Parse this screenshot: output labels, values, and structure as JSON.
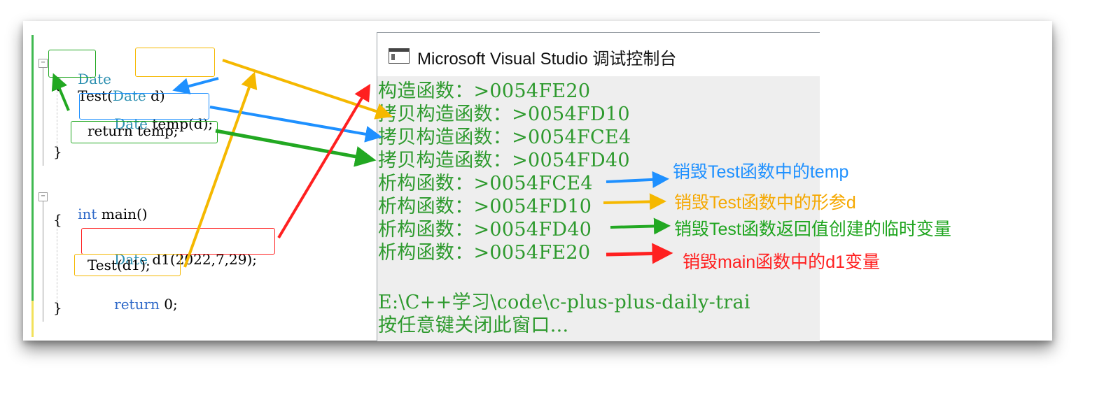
{
  "editor": {
    "code_lines": {
      "line1": {
        "type": "Date",
        "name": "Test",
        "param_type": "Date",
        "param_name": "d",
        "paren_open": "(",
        "paren_close": ")"
      },
      "line2": "{",
      "line3": {
        "type": "Date",
        "rest": "temp(d);"
      },
      "line4": "return temp;",
      "line5": "}",
      "line6": {
        "kw": "int",
        "rest": " main()"
      },
      "line7": "{",
      "line8": {
        "type": "Date",
        "rest": "d1(2022,7,29);"
      },
      "line9": "Test(d1);",
      "line10": {
        "kw": "return",
        "rest": " 0;"
      },
      "line11": "}"
    },
    "fold_symbol": "−"
  },
  "console": {
    "title": "Microsoft Visual Studio 调试控制台",
    "lines": [
      "构造函数：>0054FE20",
      "拷贝构造函数：>0054FD10",
      "拷贝构造函数：>0054FCE4",
      "拷贝构造函数：>0054FD40",
      "析构函数：>0054FCE4",
      "析构函数：>0054FD10",
      "析构函数：>0054FD40",
      "析构函数：>0054FE20",
      "",
      "E:\\C++学习\\code\\c-plus-plus-daily-trai",
      "按任意键关闭此窗口..."
    ]
  },
  "annotations": [
    {
      "text": "销毁Test函数中的temp",
      "color": "#1e90ff"
    },
    {
      "text": "销毁Test函数中的形参d",
      "color": "#f5a800"
    },
    {
      "text": "销毁Test函数返回值创建的临时变量",
      "color": "#1fa51f"
    },
    {
      "text": "销毁main函数中的d1变量",
      "color": "#ff2020"
    }
  ],
  "colors": {
    "blue": "#1e90ff",
    "orange": "#f5b800",
    "green": "#22a822",
    "red": "#ff2020",
    "console_text": "#2e9a2e",
    "console_bg": "#eeeeee"
  },
  "icons": {
    "console_window": "console-app-icon"
  }
}
